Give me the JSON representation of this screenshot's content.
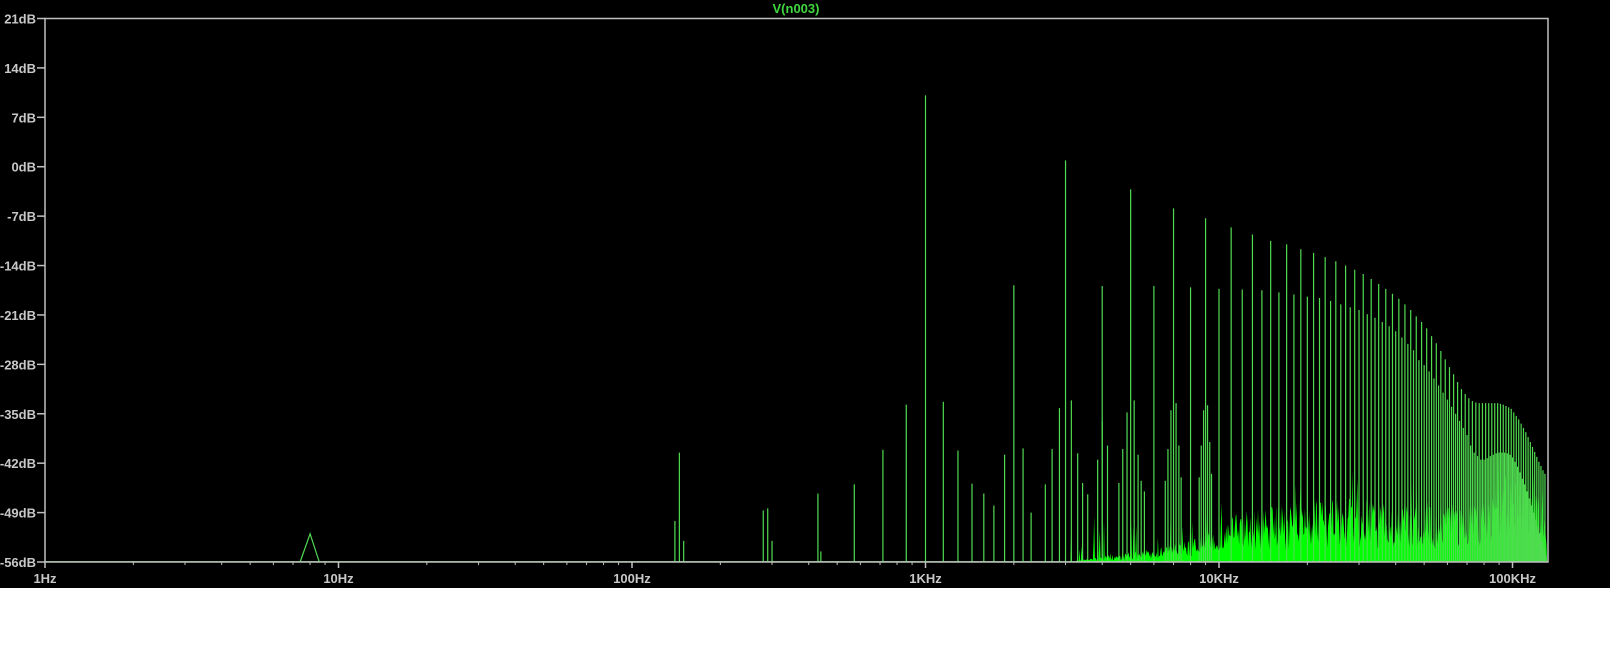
{
  "chart_data": {
    "type": "line",
    "title": "V(n003)",
    "xscale": "log",
    "xlim_hz": [
      1,
      131000
    ],
    "ylim_db": [
      -56,
      21
    ],
    "grid": false,
    "background": "#000000",
    "frame_color": "#c0c0c0",
    "trace_color": "#50dc50",
    "noise_color": "#00ff00",
    "title_color": "#40d840",
    "y_ticks": [
      {
        "value": 21,
        "label": "21dB"
      },
      {
        "value": 14,
        "label": "14dB"
      },
      {
        "value": 7,
        "label": "7dB"
      },
      {
        "value": 0,
        "label": "0dB"
      },
      {
        "value": -7,
        "label": "-7dB"
      },
      {
        "value": -14,
        "label": "-14dB"
      },
      {
        "value": -21,
        "label": "-21dB"
      },
      {
        "value": -28,
        "label": "-28dB"
      },
      {
        "value": -35,
        "label": "-35dB"
      },
      {
        "value": -42,
        "label": "-42dB"
      },
      {
        "value": -49,
        "label": "-49dB"
      },
      {
        "value": -56,
        "label": "-56dB"
      }
    ],
    "x_ticks": [
      {
        "value": 1,
        "label": "1Hz"
      },
      {
        "value": 10,
        "label": "10Hz"
      },
      {
        "value": 100,
        "label": "100Hz"
      },
      {
        "value": 1000,
        "label": "1KHz"
      },
      {
        "value": 10000,
        "label": "10KHz"
      },
      {
        "value": 100000,
        "label": "100KHz"
      }
    ],
    "low_frequency_bump": [
      [
        7.4,
        -56
      ],
      [
        8.0,
        -52
      ],
      [
        8.6,
        -56
      ]
    ],
    "odd_harmonics": [
      [
        1000,
        10.1
      ],
      [
        3000,
        0.9
      ],
      [
        5000,
        -3.2
      ],
      [
        7000,
        -5.9
      ],
      [
        9000,
        -7.3
      ],
      [
        11000,
        -8.6
      ],
      [
        13000,
        -9.6
      ],
      [
        15000,
        -10.5
      ],
      [
        17000,
        -11.0
      ],
      [
        19000,
        -11.7
      ],
      [
        21000,
        -12.2
      ],
      [
        23000,
        -12.8
      ],
      [
        25000,
        -13.4
      ],
      [
        27000,
        -14.0
      ],
      [
        29000,
        -14.6
      ],
      [
        31000,
        -15.2
      ],
      [
        33000,
        -15.9
      ],
      [
        35000,
        -16.6
      ],
      [
        37000,
        -17.3
      ],
      [
        39000,
        -18.0
      ],
      [
        41000,
        -18.7
      ],
      [
        43000,
        -19.5
      ],
      [
        45000,
        -20.3
      ],
      [
        47000,
        -21.2
      ],
      [
        49000,
        -22.0
      ],
      [
        51000,
        -22.9
      ],
      [
        53000,
        -24.0
      ],
      [
        55000,
        -25.0
      ],
      [
        57000,
        -26.1
      ],
      [
        59000,
        -27.3
      ],
      [
        61000,
        -28.4
      ],
      [
        63000,
        -29.4
      ],
      [
        65000,
        -30.5
      ],
      [
        67000,
        -31.5
      ],
      [
        69000,
        -32.2
      ],
      [
        71000,
        -32.8
      ],
      [
        73000,
        -33.2
      ],
      [
        75000,
        -33.4
      ],
      [
        77000,
        -33.5
      ],
      [
        79000,
        -33.5
      ],
      [
        81000,
        -33.5
      ],
      [
        83000,
        -33.5
      ],
      [
        85000,
        -33.5
      ],
      [
        87000,
        -33.5
      ],
      [
        89000,
        -33.5
      ],
      [
        91000,
        -33.6
      ],
      [
        93000,
        -33.7
      ],
      [
        95000,
        -33.9
      ],
      [
        97000,
        -34.1
      ],
      [
        99000,
        -34.3
      ],
      [
        101000,
        -34.8
      ],
      [
        103000,
        -35.3
      ],
      [
        105000,
        -35.8
      ],
      [
        107000,
        -36.4
      ],
      [
        109000,
        -37.0
      ],
      [
        111000,
        -37.6
      ],
      [
        113000,
        -38.3
      ],
      [
        115000,
        -39.0
      ],
      [
        117000,
        -39.7
      ],
      [
        119000,
        -40.4
      ],
      [
        121000,
        -41.1
      ],
      [
        123000,
        -41.8
      ],
      [
        125000,
        -42.4
      ],
      [
        127000,
        -43.0
      ],
      [
        129000,
        -43.5
      ]
    ],
    "even_harmonics": [
      [
        2000,
        -16.8
      ],
      [
        4000,
        -16.9
      ],
      [
        6000,
        -16.9
      ],
      [
        8000,
        -17.1
      ],
      [
        10000,
        -17.3
      ],
      [
        12000,
        -17.4
      ],
      [
        14000,
        -17.5
      ],
      [
        16000,
        -17.8
      ],
      [
        18000,
        -18.1
      ],
      [
        20000,
        -18.4
      ],
      [
        22000,
        -18.6
      ],
      [
        24000,
        -19.0
      ],
      [
        26000,
        -19.5
      ],
      [
        28000,
        -19.9
      ],
      [
        30000,
        -20.3
      ],
      [
        32000,
        -20.9
      ],
      [
        34000,
        -21.4
      ],
      [
        36000,
        -22.0
      ],
      [
        38000,
        -22.6
      ],
      [
        40000,
        -23.3
      ],
      [
        42000,
        -24.2
      ],
      [
        44000,
        -25.1
      ],
      [
        46000,
        -26.0
      ],
      [
        48000,
        -27.4
      ],
      [
        50000,
        -28.1
      ],
      [
        52000,
        -29.0
      ],
      [
        54000,
        -30.0
      ],
      [
        56000,
        -31.0
      ],
      [
        58000,
        -32.0
      ],
      [
        60000,
        -33.0
      ],
      [
        62000,
        -34.0
      ],
      [
        64000,
        -35.0
      ],
      [
        66000,
        -36.0
      ],
      [
        68000,
        -37.0
      ],
      [
        70000,
        -38.0
      ],
      [
        72000,
        -39.5
      ],
      [
        74000,
        -40.5
      ],
      [
        76000,
        -41.0
      ],
      [
        78000,
        -41.5
      ],
      [
        80000,
        -41.5
      ],
      [
        82000,
        -41.3
      ],
      [
        84000,
        -41.0
      ],
      [
        86000,
        -40.8
      ],
      [
        88000,
        -40.6
      ],
      [
        90000,
        -40.5
      ],
      [
        92000,
        -40.5
      ],
      [
        94000,
        -40.5
      ],
      [
        96000,
        -40.6
      ],
      [
        98000,
        -40.8
      ],
      [
        100000,
        -41.2
      ],
      [
        102000,
        -41.8
      ],
      [
        104000,
        -42.5
      ],
      [
        106000,
        -43.3
      ],
      [
        108000,
        -44.2
      ],
      [
        110000,
        -45.0
      ],
      [
        112000,
        -46.0
      ],
      [
        114000,
        -47.0
      ],
      [
        116000,
        -48.0
      ],
      [
        118000,
        -49.0
      ],
      [
        120000,
        -50.0
      ],
      [
        122000,
        -51.0
      ],
      [
        124000,
        -52.0
      ],
      [
        126000,
        -53.0
      ],
      [
        128000,
        -54.0
      ],
      [
        130000,
        -55.0
      ]
    ],
    "spurs": [
      [
        140,
        -50.2
      ],
      [
        145,
        -40.5
      ],
      [
        150,
        -53.0
      ],
      [
        280,
        -48.7
      ],
      [
        290,
        -48.4
      ],
      [
        300,
        -53.0
      ],
      [
        430,
        -46.3
      ],
      [
        440,
        -54.5
      ],
      [
        572,
        -45.0
      ],
      [
        716,
        -40.1
      ],
      [
        860,
        -33.7
      ],
      [
        1150,
        -33.3
      ],
      [
        1290,
        -40.2
      ],
      [
        1440,
        -44.9
      ],
      [
        1580,
        -46.3
      ],
      [
        1710,
        -48.0
      ],
      [
        1860,
        -40.8
      ],
      [
        2150,
        -39.9
      ],
      [
        2290,
        -49.0
      ],
      [
        2560,
        -45.0
      ],
      [
        2700,
        -40.0
      ],
      [
        2860,
        -34.2
      ],
      [
        3140,
        -33.1
      ],
      [
        3300,
        -40.6
      ],
      [
        3430,
        -44.8
      ],
      [
        3570,
        -46.4
      ],
      [
        3860,
        -41.5
      ],
      [
        4000,
        -36.0
      ],
      [
        4170,
        -39.5
      ],
      [
        4560,
        -44.8
      ],
      [
        4700,
        -40.0
      ],
      [
        4860,
        -34.8
      ],
      [
        5140,
        -33.1
      ],
      [
        5300,
        -40.8
      ],
      [
        5430,
        -44.5
      ],
      [
        5570,
        -46.0
      ],
      [
        6560,
        -44.5
      ],
      [
        6700,
        -40.0
      ],
      [
        6860,
        -34.5
      ],
      [
        7140,
        -33.5
      ],
      [
        7300,
        -39.5
      ],
      [
        7430,
        -44.0
      ],
      [
        8560,
        -44.0
      ],
      [
        8700,
        -39.5
      ],
      [
        8860,
        -34.5
      ],
      [
        9140,
        -33.8
      ],
      [
        9300,
        -39.0
      ],
      [
        9430,
        -43.5
      ]
    ],
    "noise_floor": [
      [
        3000,
        -56
      ],
      [
        6000,
        -54
      ],
      [
        9000,
        -52
      ],
      [
        11000,
        -49
      ],
      [
        15000,
        -48
      ],
      [
        20000,
        -47
      ],
      [
        30000,
        -47
      ],
      [
        50000,
        -48
      ],
      [
        70000,
        -47
      ],
      [
        85000,
        -45
      ],
      [
        95000,
        -43
      ],
      [
        105000,
        -43
      ],
      [
        120000,
        -46
      ],
      [
        131000,
        -50
      ]
    ]
  }
}
